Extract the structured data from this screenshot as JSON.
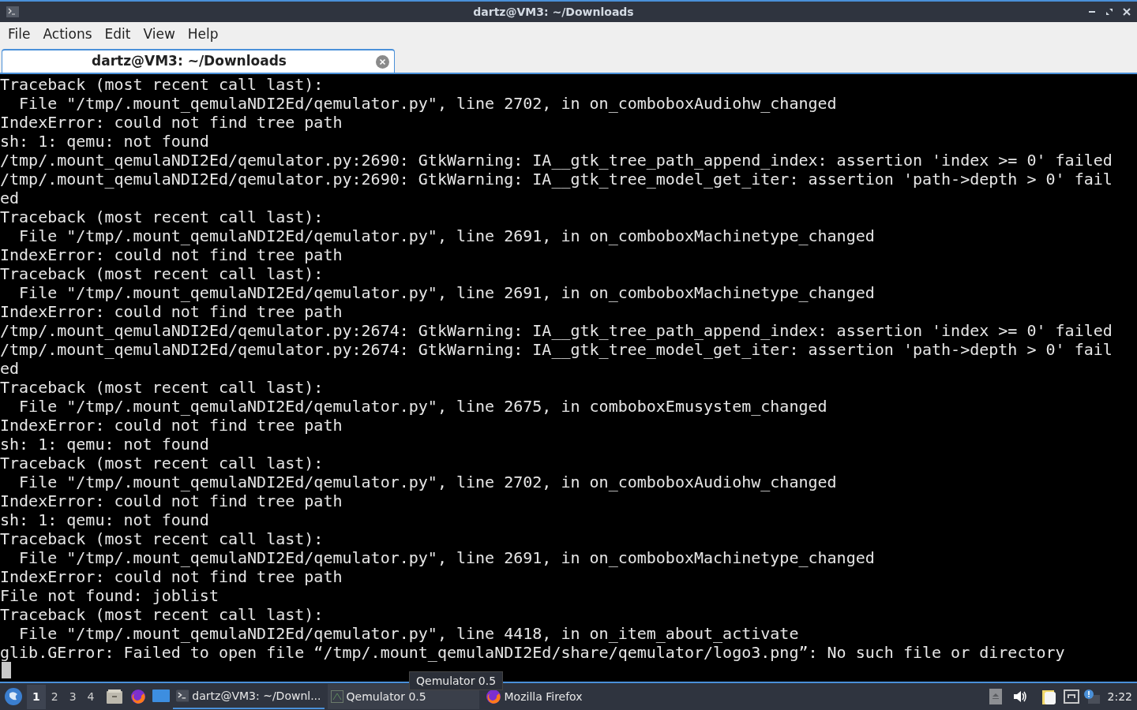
{
  "window": {
    "title": "dartz@VM3: ~/Downloads"
  },
  "menu": [
    "File",
    "Actions",
    "Edit",
    "View",
    "Help"
  ],
  "tabs": [
    {
      "label": "dartz@VM3: ~/Downloads",
      "selected": true
    }
  ],
  "terminal": {
    "lines": [
      "Traceback (most recent call last):",
      "  File \"/tmp/.mount_qemulaNDI2Ed/qemulator.py\", line 2702, in on_comboboxAudiohw_changed",
      "IndexError: could not find tree path",
      "sh: 1: qemu: not found",
      "/tmp/.mount_qemulaNDI2Ed/qemulator.py:2690: GtkWarning: IA__gtk_tree_path_append_index: assertion 'index >= 0' failed",
      "/tmp/.mount_qemulaNDI2Ed/qemulator.py:2690: GtkWarning: IA__gtk_tree_model_get_iter: assertion 'path->depth > 0' fail",
      "ed",
      "Traceback (most recent call last):",
      "  File \"/tmp/.mount_qemulaNDI2Ed/qemulator.py\", line 2691, in on_comboboxMachinetype_changed",
      "IndexError: could not find tree path",
      "Traceback (most recent call last):",
      "  File \"/tmp/.mount_qemulaNDI2Ed/qemulator.py\", line 2691, in on_comboboxMachinetype_changed",
      "IndexError: could not find tree path",
      "/tmp/.mount_qemulaNDI2Ed/qemulator.py:2674: GtkWarning: IA__gtk_tree_path_append_index: assertion 'index >= 0' failed",
      "/tmp/.mount_qemulaNDI2Ed/qemulator.py:2674: GtkWarning: IA__gtk_tree_model_get_iter: assertion 'path->depth > 0' fail",
      "ed",
      "Traceback (most recent call last):",
      "  File \"/tmp/.mount_qemulaNDI2Ed/qemulator.py\", line 2675, in comboboxEmusystem_changed",
      "IndexError: could not find tree path",
      "sh: 1: qemu: not found",
      "Traceback (most recent call last):",
      "  File \"/tmp/.mount_qemulaNDI2Ed/qemulator.py\", line 2702, in on_comboboxAudiohw_changed",
      "IndexError: could not find tree path",
      "sh: 1: qemu: not found",
      "Traceback (most recent call last):",
      "  File \"/tmp/.mount_qemulaNDI2Ed/qemulator.py\", line 2691, in on_comboboxMachinetype_changed",
      "IndexError: could not find tree path",
      "File not found: joblist",
      "Traceback (most recent call last):",
      "  File \"/tmp/.mount_qemulaNDI2Ed/qemulator.py\", line 4418, in on_item_about_activate",
      "glib.GError: Failed to open file “/tmp/.mount_qemulaNDI2Ed/share/qemulator/logo3.png”: No such file or directory"
    ]
  },
  "taskbar": {
    "workspaces": [
      {
        "label": "1",
        "selected": true
      },
      {
        "label": "2",
        "selected": false
      },
      {
        "label": "3",
        "selected": false
      },
      {
        "label": "4",
        "selected": false
      }
    ],
    "tasks": [
      {
        "kind": "terminal",
        "label": "dartz@VM3: ~/Downl...",
        "selected": true
      },
      {
        "kind": "app",
        "label": "Qemulator 0.5",
        "selected": false
      },
      {
        "kind": "browser",
        "label": "Mozilla Firefox",
        "selected": false
      }
    ],
    "tooltip": "Qemulator 0.5",
    "clock": "2:22"
  }
}
